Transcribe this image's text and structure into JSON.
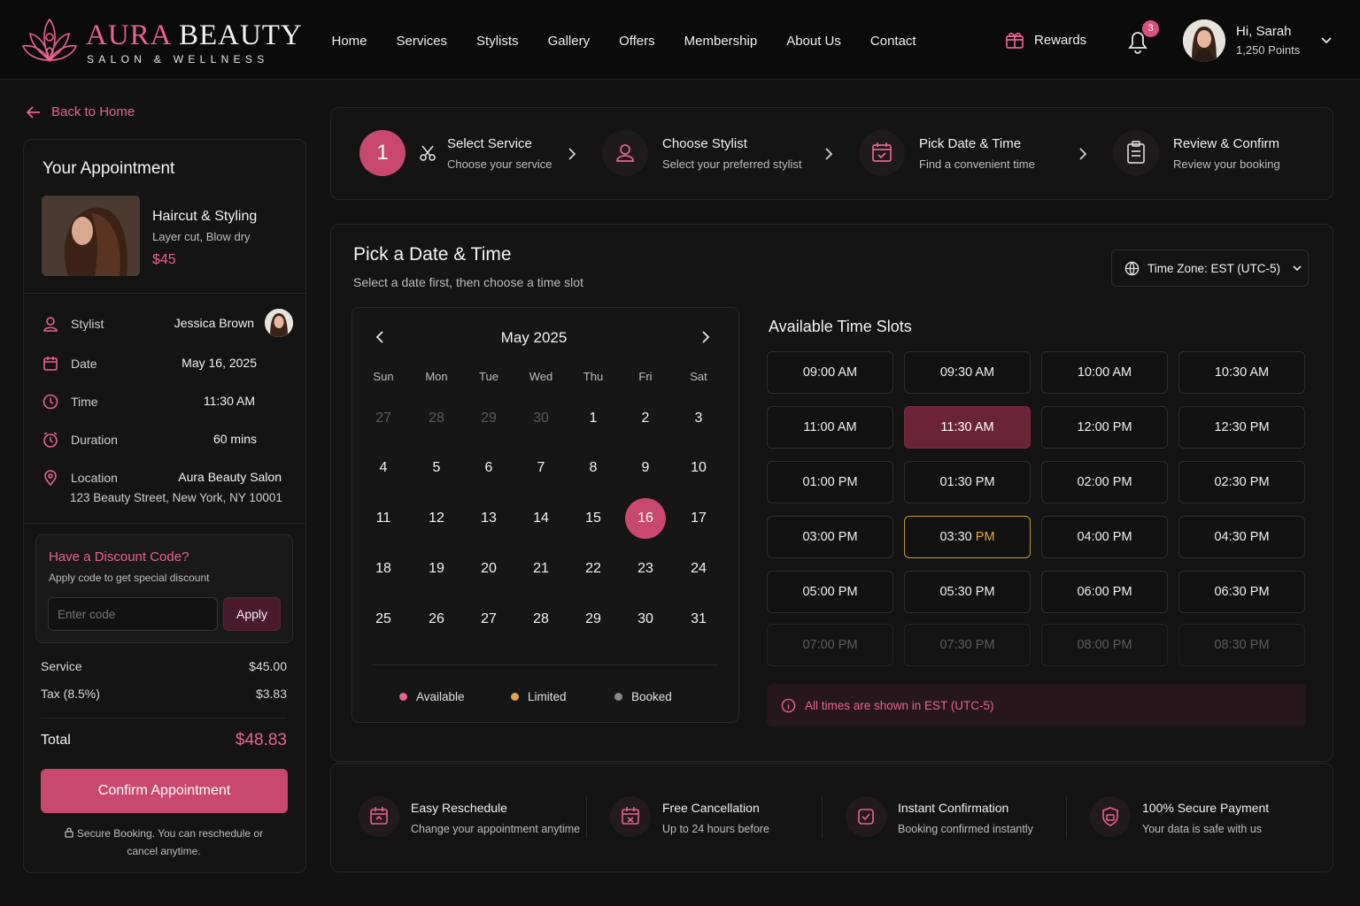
{
  "brand": {
    "name_accent": "AURA",
    "name_rest": "BEAUTY",
    "tagline": "SALON & WELLNESS"
  },
  "nav": [
    "Home",
    "Services",
    "Stylists",
    "Gallery",
    "Offers",
    "Membership",
    "About Us",
    "Contact"
  ],
  "header": {
    "rewards_label": "Rewards",
    "notification_count": "3",
    "greeting": "Hi, Sarah",
    "points": "1,250 Points"
  },
  "sidebar": {
    "back_label": "Back to Home",
    "title": "Your Appointment",
    "service": {
      "name": "Haircut & Styling",
      "desc": "Layer cut, Blow dry",
      "price": "$45"
    },
    "details": {
      "stylist_label": "Stylist",
      "stylist_value": "Jessica Brown",
      "date_label": "Date",
      "date_value": "May 16, 2025",
      "time_label": "Time",
      "time_value": "11:30 AM",
      "duration_label": "Duration",
      "duration_value": "60 mins",
      "location_label": "Location",
      "location_value": "Aura Beauty Salon",
      "location_address": "123 Beauty Street, New York, NY 10001"
    },
    "discount": {
      "title": "Have a Discount Code?",
      "subtitle": "Apply code to get special discount",
      "placeholder": "Enter code",
      "apply_label": "Apply"
    },
    "pricing": {
      "service_label": "Service",
      "service_value": "$45.00",
      "tax_label": "Tax (8.5%)",
      "tax_value": "$3.83",
      "total_label": "Total",
      "total_value": "$48.83"
    },
    "confirm_label": "Confirm Appointment",
    "secure_note": "Secure Booking. You can reschedule or cancel anytime."
  },
  "steps": [
    {
      "number": "1",
      "title": "Select Service",
      "subtitle": "Choose your service"
    },
    {
      "title": "Choose Stylist",
      "subtitle": "Select your preferred stylist"
    },
    {
      "title": "Pick Date & Time",
      "subtitle": "Find a convenient time"
    },
    {
      "title": "Review & Confirm",
      "subtitle": "Review your booking"
    }
  ],
  "main": {
    "title": "Pick a Date & Time",
    "subtitle": "Select a date first, then choose a time slot",
    "timezone_label": "Time Zone: EST (UTC-5)"
  },
  "calendar": {
    "month_label": "May 2025",
    "weekdays": [
      "Sun",
      "Mon",
      "Tue",
      "Wed",
      "Thu",
      "Fri",
      "Sat"
    ],
    "leading_days": [
      "27",
      "28",
      "29",
      "30"
    ],
    "days_in_month": 31,
    "selected_day": "16",
    "legend": {
      "available": "Available",
      "limited": "Limited",
      "booked": "Booked"
    },
    "colors": {
      "available": "#e8638f",
      "limited": "#e6a548",
      "booked": "#8a8a8a"
    }
  },
  "slots": {
    "title": "Available Time Slots",
    "items": [
      {
        "time": "09:00 AM",
        "state": "available"
      },
      {
        "time": "09:30 AM",
        "state": "available"
      },
      {
        "time": "10:00 AM",
        "state": "available"
      },
      {
        "time": "10:30 AM",
        "state": "available"
      },
      {
        "time": "11:00 AM",
        "state": "available"
      },
      {
        "time": "11:30 AM",
        "state": "selected"
      },
      {
        "time": "12:00 PM",
        "state": "available"
      },
      {
        "time": "12:30 PM",
        "state": "available"
      },
      {
        "time": "01:00 PM",
        "state": "available"
      },
      {
        "time": "01:30 PM",
        "state": "available"
      },
      {
        "time": "02:00 PM",
        "state": "available"
      },
      {
        "time": "02:30 PM",
        "state": "available"
      },
      {
        "time": "03:00 PM",
        "state": "available"
      },
      {
        "time": "03:30 PM",
        "state": "limited"
      },
      {
        "time": "04:00 PM",
        "state": "available"
      },
      {
        "time": "04:30 PM",
        "state": "available"
      },
      {
        "time": "05:00 PM",
        "state": "available"
      },
      {
        "time": "05:30 PM",
        "state": "available"
      },
      {
        "time": "06:00 PM",
        "state": "available"
      },
      {
        "time": "06:30 PM",
        "state": "available"
      },
      {
        "time": "07:00 PM",
        "state": "booked"
      },
      {
        "time": "07:30 PM",
        "state": "booked"
      },
      {
        "time": "08:00 PM",
        "state": "booked"
      },
      {
        "time": "08:30 PM",
        "state": "booked"
      }
    ],
    "note": "All times are shown in EST (UTC-5)"
  },
  "features": [
    {
      "title": "Easy Reschedule",
      "subtitle": "Change your appointment anytime"
    },
    {
      "title": "Free Cancellation",
      "subtitle": "Up to 24 hours before"
    },
    {
      "title": "Instant Confirmation",
      "subtitle": "Booking confirmed instantly"
    },
    {
      "title": "100% Secure Payment",
      "subtitle": "Your data is safe with us"
    }
  ],
  "accent_color": "#c9486f"
}
